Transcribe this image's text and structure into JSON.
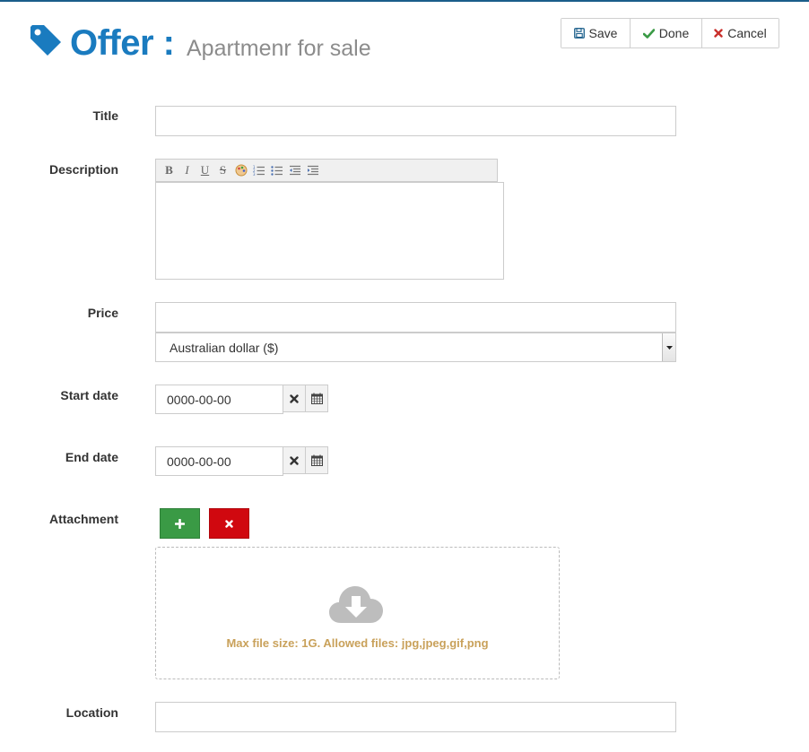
{
  "header": {
    "title": "Offer :",
    "subtitle": "Apartmenr for sale"
  },
  "toolbar": {
    "save_label": "Save",
    "done_label": "Done",
    "cancel_label": "Cancel"
  },
  "form": {
    "title_label": "Title",
    "title_value": "",
    "description_label": "Description",
    "editor_buttons": [
      "B",
      "I",
      "U",
      "S"
    ],
    "price_label": "Price",
    "price_value": "",
    "currency_selected": "Australian dollar ($)",
    "start_date_label": "Start date",
    "start_date_value": "0000-00-00",
    "end_date_label": "End date",
    "end_date_value": "0000-00-00",
    "attachment_label": "Attachment",
    "dropzone_text": "Max file size: 1G. Allowed files: jpg,jpeg,gif,png",
    "location_label": "Location",
    "location_value": ""
  },
  "colors": {
    "brand_blue": "#1a7bbf",
    "subtitle_gray": "#8c8c8c",
    "done_green": "#3a9a45",
    "cancel_red": "#d0080f",
    "dropzone_text": "#c9a15a"
  },
  "icons": {
    "header": "tag-icon",
    "save": "floppy-icon",
    "done": "check-icon",
    "cancel": "close-icon",
    "date_clear": "close-icon",
    "date_pick": "calendar-icon",
    "add": "plus-icon",
    "remove": "close-icon",
    "dropzone": "cloud-download-icon"
  }
}
